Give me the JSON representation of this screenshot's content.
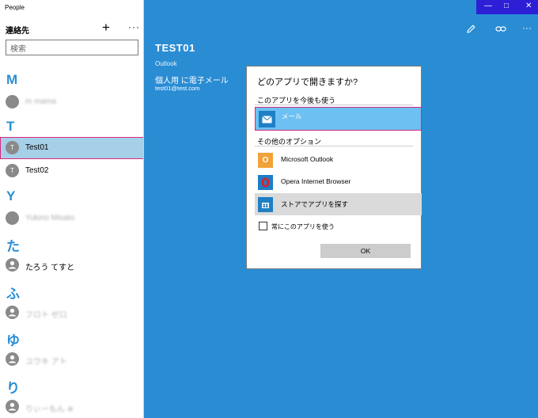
{
  "app": {
    "title": "People"
  },
  "window": {
    "minimize_icon": "minimize-icon",
    "maximize_icon": "maximize-icon",
    "close_icon": "close-icon"
  },
  "left": {
    "title": "連絡先",
    "add_label": "+",
    "more_label": "···",
    "search_placeholder": "検索",
    "letters": {
      "m": "M",
      "t": "T",
      "y": "Y",
      "ta": "た",
      "fu": "ふ",
      "yu": "ゆ",
      "ri": "り"
    },
    "contacts": [
      {
        "initial": "",
        "name": "m mama",
        "blurred": true
      },
      {
        "initial": "T",
        "name": "Test01",
        "blurred": false,
        "selected": true
      },
      {
        "initial": "T",
        "name": "Test02",
        "blurred": false
      },
      {
        "initial": "",
        "name": "Yukino Misato",
        "blurred": true
      },
      {
        "initial": "",
        "name": "たろう てすと",
        "blurred": false
      },
      {
        "initial": "",
        "name": "フロト ゼロ",
        "blurred": true
      },
      {
        "initial": "",
        "name": "ユウキ アト",
        "blurred": true
      },
      {
        "initial": "",
        "name": "りぃーもん ※",
        "blurred": true
      }
    ]
  },
  "toolbar": {
    "edit_icon": "pencil-icon",
    "link_icon": "link-icon",
    "more_label": "···"
  },
  "detail": {
    "name": "TEST01",
    "source": "Outlook",
    "email_label": "個人用 に電子メール",
    "email": "test01@test.com"
  },
  "dialog": {
    "title": "どのアプリで開きますか?",
    "keep_section": "このアプリを今後も使う",
    "mail_label": "メール",
    "other_section": "その他のオプション",
    "options": [
      {
        "label": "Microsoft Outlook"
      },
      {
        "label": "Opera Internet Browser"
      },
      {
        "label": "ストアでアプリを探す"
      }
    ],
    "always_label": "常にこのアプリを使う",
    "ok_label": "OK"
  }
}
